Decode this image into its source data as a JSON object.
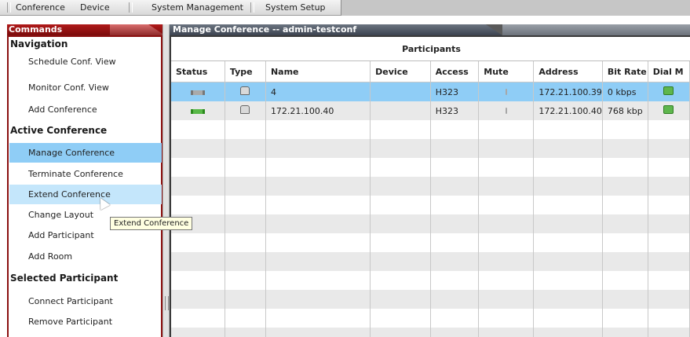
{
  "menu": {
    "items": [
      "Conference",
      "Device",
      "System Management",
      "System Setup"
    ]
  },
  "commands": {
    "header": "Commands",
    "sections": [
      {
        "title": "Navigation",
        "items": [
          "Schedule Conf. View",
          "Monitor Conf. View",
          "Add Conference"
        ]
      },
      {
        "title": "Active Conference",
        "items": [
          "Manage Conference",
          "Terminate Conference",
          "Extend Conference",
          "Change Layout",
          "Add Participant",
          "Add Room"
        ]
      },
      {
        "title": "Selected Participant",
        "items": [
          "Connect Participant",
          "Remove Participant"
        ]
      }
    ],
    "active_item": "Manage Conference",
    "hover_item": "Extend Conference"
  },
  "manage": {
    "title": "Manage Conference -- admin-testconf",
    "participants_title": "Participants",
    "columns": [
      "Status",
      "Type",
      "Name",
      "Device",
      "Access",
      "Mute",
      "Address",
      "Bit Rate",
      "Dial M"
    ],
    "rows": [
      {
        "status_icon": "connecting-status-icon",
        "type_icon": "endpoint-icon",
        "name": "4",
        "device": "",
        "access": "H323",
        "mute_icon": "mic-icon",
        "address": "172.21.100.39",
        "bitrate": "0 kbps",
        "dial_icon": "dial-out-icon",
        "selected": true
      },
      {
        "status_icon": "connected-status-icon",
        "type_icon": "endpoint-icon",
        "name": "172.21.100.40",
        "device": "",
        "access": "H323",
        "mute_icon": "mic-icon",
        "address": "172.21.100.40",
        "bitrate": "768 kbp",
        "dial_icon": "dial-out-icon",
        "selected": false
      }
    ]
  },
  "tooltip": "Extend Conference",
  "colors": {
    "selected_row": "#8fcdf6",
    "hover_row": "#c4e6fb",
    "panel_border": "#8b1010"
  }
}
